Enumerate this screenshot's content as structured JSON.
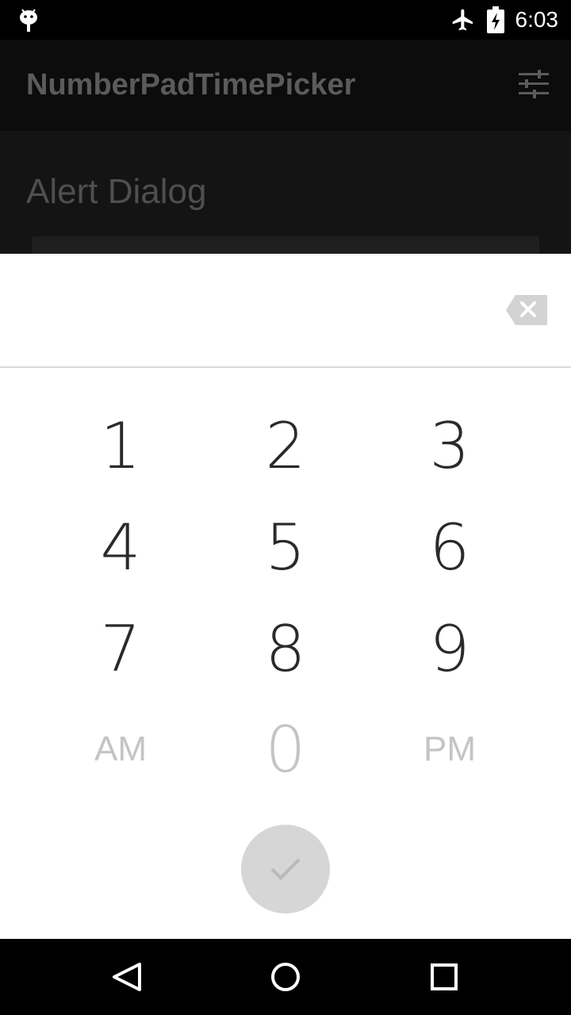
{
  "status_bar": {
    "time": "6:03",
    "icons": [
      "android-debug-icon",
      "airplane-mode-icon",
      "battery-charging-icon"
    ]
  },
  "app_bar": {
    "title": "NumberPadTimePicker",
    "action_icon": "tune-icon"
  },
  "content": {
    "section_title": "Alert Dialog"
  },
  "dialog": {
    "time_display": "",
    "backspace_icon": "backspace-icon",
    "keys": {
      "k1": "1",
      "k2": "2",
      "k3": "3",
      "k4": "4",
      "k5": "5",
      "k6": "6",
      "k7": "7",
      "k8": "8",
      "k9": "9",
      "am": "AM",
      "k0": "0",
      "pm": "PM"
    },
    "done_icon": "check-icon"
  },
  "nav_bar": {
    "icons": [
      "back-icon",
      "home-icon",
      "recents-icon"
    ]
  },
  "colors": {
    "dialog_bg": "#ffffff",
    "key_text": "#2a2a2a",
    "key_disabled": "#c4c4c4",
    "done_button_bg": "#d6d6d6"
  }
}
